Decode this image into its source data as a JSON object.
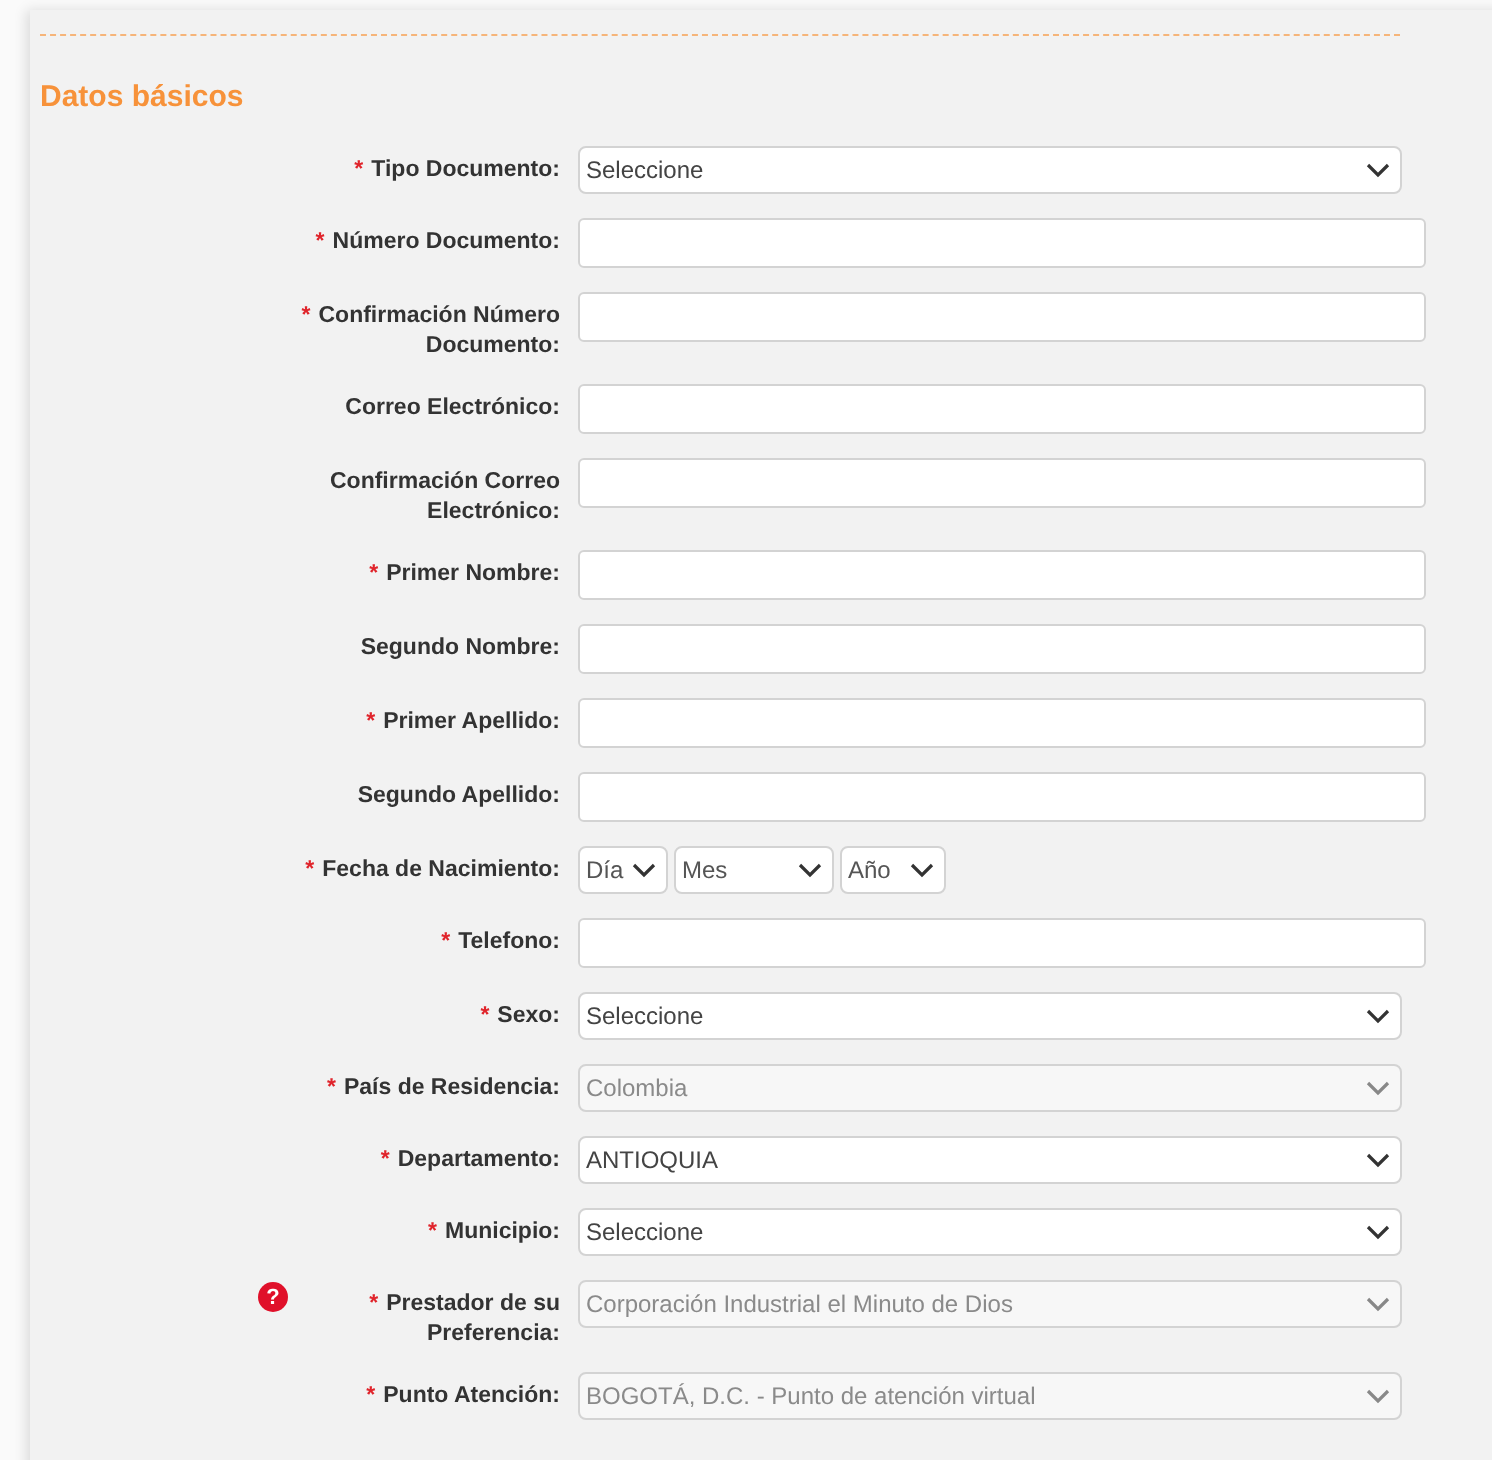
{
  "section": {
    "title": "Datos básicos"
  },
  "fields": [
    {
      "kind": "select",
      "mark": "*",
      "label": "Tipo Documento:",
      "value": "Seleccione",
      "disabled": false
    },
    {
      "kind": "text",
      "mark": "*",
      "label": "Número Documento:"
    },
    {
      "kind": "text",
      "mark": "*",
      "label": "Confirmación Número Documento:"
    },
    {
      "kind": "text",
      "label": "Correo Electrónico:"
    },
    {
      "kind": "text",
      "label": "Confirmación Correo Electrónico:"
    },
    {
      "kind": "text",
      "mark": "*",
      "label": "Primer Nombre:"
    },
    {
      "kind": "text",
      "label": "Segundo Nombre:"
    },
    {
      "kind": "text",
      "mark": "*",
      "label": "Primer Apellido:"
    },
    {
      "kind": "text",
      "label": "Segundo Apellido:"
    },
    {
      "kind": "date",
      "mark": "*",
      "label": "Fecha de Nacimiento:",
      "parts": [
        {
          "value": "Día"
        },
        {
          "value": "Mes"
        },
        {
          "value": "Año"
        }
      ]
    },
    {
      "kind": "text",
      "mark": "*",
      "label": "Telefono:"
    },
    {
      "kind": "select",
      "mark": "*",
      "label": "Sexo:",
      "value": "Seleccione",
      "disabled": false
    },
    {
      "kind": "select",
      "mark": "*",
      "label": "País de Residencia:",
      "value": "Colombia",
      "disabled": true
    },
    {
      "kind": "select",
      "mark": "*",
      "label": "Departamento:",
      "value": "ANTIOQUIA",
      "disabled": false
    },
    {
      "kind": "select",
      "mark": "*",
      "label": "Municipio:",
      "value": "Seleccione",
      "disabled": false
    },
    {
      "kind": "select",
      "help": "?",
      "mark": "*",
      "label": "Prestador de su Preferencia:",
      "value": "Corporación Industrial el Minuto de Dios",
      "disabled": true
    },
    {
      "kind": "select",
      "mark": "*",
      "label": "Punto Atención:",
      "value": "BOGOTÁ, D.C. - Punto de atención virtual",
      "disabled": true
    }
  ]
}
